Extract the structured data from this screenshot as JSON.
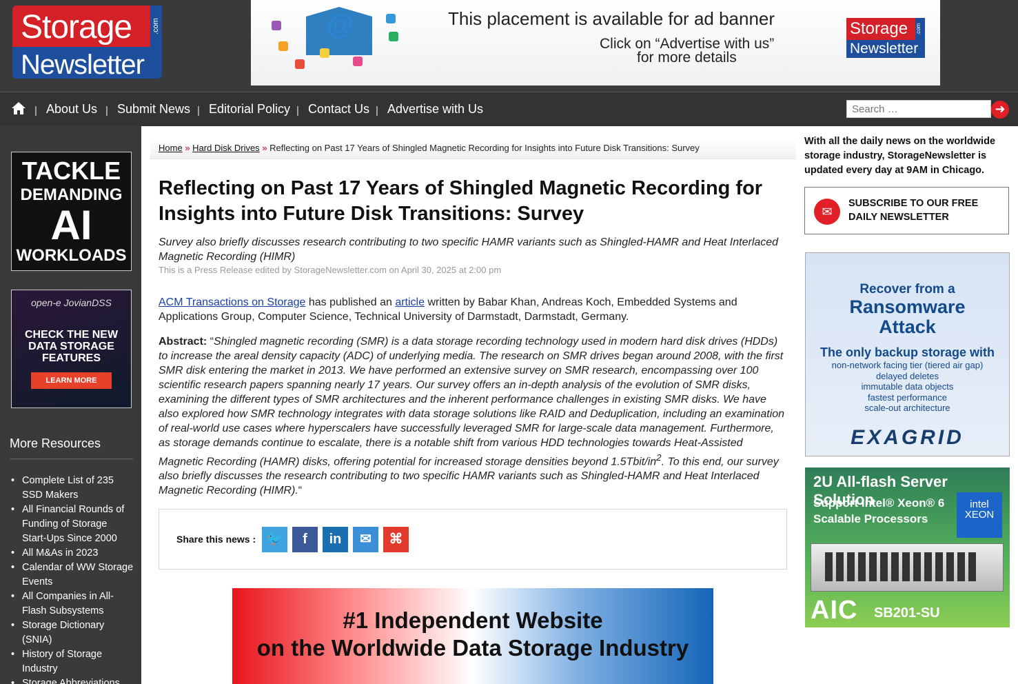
{
  "header": {
    "logo": {
      "line1": "Storage",
      "line2": "Newsletter",
      "suffix": ".com"
    },
    "ad": {
      "line1": "This placement is available for ad banner",
      "line2": "Click on “Advertise with us”",
      "line3": "for more details",
      "logo_line1": "Storage",
      "logo_line2": "Newsletter",
      "logo_suffix": ".com"
    }
  },
  "nav": {
    "home_icon": "home-icon",
    "links": [
      "About Us",
      "Submit News",
      "Editorial Policy",
      "Contact Us",
      "Advertise with Us"
    ],
    "search_placeholder": "Search …",
    "search_icon": "arrow-right-icon"
  },
  "left_sidebar": {
    "ad_ai": {
      "w1": "TACKLE",
      "w2": "DEMANDING",
      "w3": "AI",
      "w4": "WORKLOADS"
    },
    "ad_dss": {
      "brand": "open-e JovianDSS",
      "headline": "CHECK THE NEW DATA STORAGE FEATURES",
      "cta": "LEARN MORE"
    },
    "more_resources": "More Resources",
    "resources": [
      "Complete List of 235 SSD Makers",
      "All Financial Rounds of Funding of Storage Start-Ups Since 2000",
      "All M&As in 2023",
      "Calendar of WW Storage Events",
      "All Companies in All-Flash Subsystems",
      "Storage Dictionary (SNIA)",
      "History of Storage Industry",
      "Storage Abbreviations"
    ]
  },
  "breadcrumb": {
    "home": "Home",
    "category": "Hard Disk Drives",
    "sep": "»",
    "current": "Reflecting on Past 17 Years of Shingled Magnetic Recording for Insights into Future Disk Transitions: Survey"
  },
  "article": {
    "title": "Reflecting on Past 17 Years of Shingled Magnetic Recording for Insights into Future Disk Transitions: Survey",
    "subtitle": "Survey also briefly discusses research contributing to two specific HAMR variants such as Shingled-HAMR and Heat Interlaced Magnetic Recording (HIMR)",
    "byline": "This is a Press Release edited by StorageNewsletter.com on April 30, 2025 at 2:00 pm",
    "intro_link1": "ACM Transactions on Storage",
    "intro_mid": " has published an ",
    "intro_link2": "article",
    "intro_rest": " written by Babar Khan, Andreas Koch, Embedded Systems and Applications Group, Computer Science, Technical University of Darmstadt, Darmstadt, Germany.",
    "abstract_label": "Abstract:",
    "abstract_open": " “",
    "abstract_part1": "Shingled magnetic recording (SMR) is a data storage recording technology used in modern hard disk drives (HDDs) to increase the areal density capacity (ADC) of underlying media. The research on SMR drives began around 2008, with the first SMR disk entering the market in 2013. We have performed an extensive survey on SMR research, encompassing over 100 scientific research papers spanning nearly 17 years. Our survey offers an in-depth analysis of the evolution of SMR disks, examining the different types of SMR architectures and the inherent performance challenges in existing SMR disks. We have also explored how SMR technology integrates with data storage solutions like RAID and Deduplication, including an examination of real-world use cases where hyperscalers have successfully leveraged SMR for large-scale data management. Furthermore, as storage demands continue to escalate, there is a notable shift from various HDD technologies towards Heat-Assisted Magnetic Recording (HAMR) disks, offering potential for increased storage densities beyond 1.5Tbit/in",
    "abstract_sup": "2",
    "abstract_part2": ". To this end, our survey also briefly discusses the research contributing to two specific HAMR variants such as Shingled-HAMR and Heat Interlaced Magnetic Recording (HIMR).",
    "abstract_close": "“"
  },
  "share": {
    "label": "Share this news :",
    "buttons": [
      {
        "name": "twitter-icon",
        "glyph": "🐦",
        "color": "#3fa3e0"
      },
      {
        "name": "facebook-icon",
        "glyph": "f",
        "color": "#3b5998"
      },
      {
        "name": "linkedin-icon",
        "glyph": "in",
        "color": "#1a6fb0"
      },
      {
        "name": "email-icon",
        "glyph": "✉",
        "color": "#3a8fd6"
      },
      {
        "name": "pdf-icon",
        "glyph": "⌘",
        "color": "#e23a2a"
      }
    ]
  },
  "bottom_banner": {
    "line1": "#1 Independent Website",
    "line2": "on the Worldwide Data Storage Industry"
  },
  "right_sidebar": {
    "update_note": "With all the daily news on the worldwide storage industry, StorageNewsletter is updated every day at 9AM in Chicago.",
    "subscribe": "SUBSCRIBE TO OUR FREE DAILY NEWSLETTER",
    "ad_exagrid": {
      "r1": "Recover from a",
      "r2a": "Ransomware",
      "r2b": "Attack",
      "r3": "The only backup storage with",
      "bullets": [
        "non-network facing tier (tiered air gap)",
        "delayed deletes",
        "immutable data objects",
        "fastest performance",
        "scale-out architecture"
      ],
      "brand": "EXAGRID"
    },
    "ad_server": {
      "title": "2U All-flash Server Solution",
      "sub1": "Support Intel® Xeon® 6",
      "sub2": "Scalable Processors",
      "intel1": "intel",
      "intel2": "XEON",
      "brand": "AIC",
      "model": "SB201-SU"
    }
  },
  "colors": {
    "brand_red": "#d42027",
    "brand_blue": "#1e4f9c",
    "nav_bg": "#333333",
    "link_blue": "#1a3fa8"
  }
}
